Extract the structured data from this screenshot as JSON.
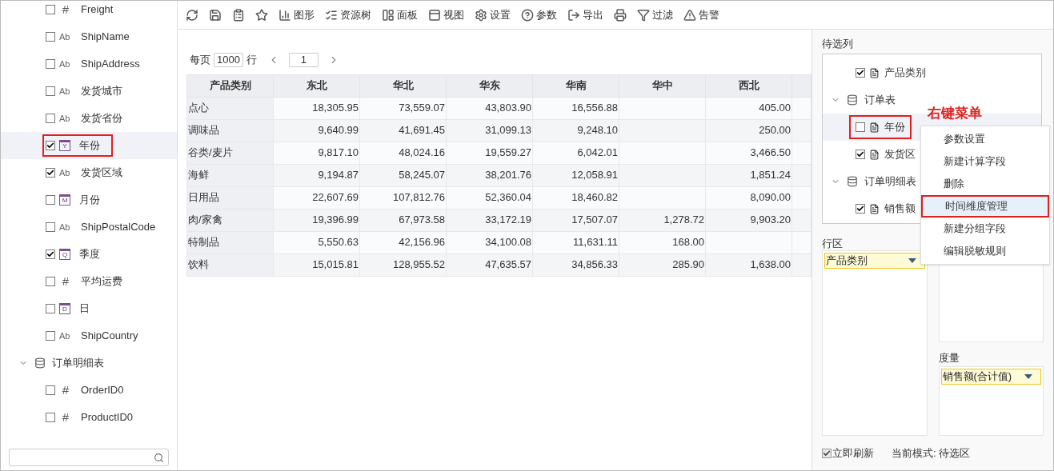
{
  "sidebar": {
    "items": [
      {
        "kind": "number",
        "type_label": "#",
        "label": "Freight",
        "checked": false,
        "selected": false,
        "outlined": false
      },
      {
        "kind": "text",
        "type_label": "Ab",
        "label": "ShipName",
        "checked": false,
        "selected": false,
        "outlined": false
      },
      {
        "kind": "text",
        "type_label": "Ab",
        "label": "ShipAddress",
        "checked": false,
        "selected": false,
        "outlined": false
      },
      {
        "kind": "text",
        "type_label": "Ab",
        "label": "发货城市",
        "checked": false,
        "selected": false,
        "outlined": false
      },
      {
        "kind": "text",
        "type_label": "Ab",
        "label": "发货省份",
        "checked": false,
        "selected": false,
        "outlined": false
      },
      {
        "kind": "date",
        "type_label": "Y",
        "label": "年份",
        "checked": true,
        "selected": true,
        "outlined": true
      },
      {
        "kind": "text",
        "type_label": "Ab",
        "label": "发货区域",
        "checked": true,
        "selected": false,
        "outlined": false
      },
      {
        "kind": "date",
        "type_label": "M",
        "label": "月份",
        "checked": false,
        "selected": false,
        "outlined": false
      },
      {
        "kind": "text",
        "type_label": "Ab",
        "label": "ShipPostalCode",
        "checked": false,
        "selected": false,
        "outlined": false
      },
      {
        "kind": "date",
        "type_label": "Q",
        "label": "季度",
        "checked": true,
        "selected": false,
        "outlined": false
      },
      {
        "kind": "number",
        "type_label": "#",
        "label": "平均运费",
        "checked": false,
        "selected": false,
        "outlined": false
      },
      {
        "kind": "date",
        "type_label": "D",
        "label": "日",
        "checked": false,
        "selected": false,
        "outlined": false
      },
      {
        "kind": "text",
        "type_label": "Ab",
        "label": "ShipCountry",
        "checked": false,
        "selected": false,
        "outlined": false
      },
      {
        "kind": "table",
        "label": "订单明细表",
        "expanded": true,
        "children": [
          {
            "kind": "number",
            "type_label": "#",
            "label": "OrderID0",
            "checked": false,
            "selected": false,
            "outlined": false
          },
          {
            "kind": "number",
            "type_label": "#",
            "label": "ProductID0",
            "checked": false,
            "selected": false,
            "outlined": false
          }
        ]
      }
    ]
  },
  "toolbar": [
    {
      "kind": "refresh"
    },
    {
      "kind": "save"
    },
    {
      "kind": "save-as"
    },
    {
      "kind": "favorite"
    },
    {
      "kind": "chart",
      "label": "图形"
    },
    {
      "kind": "tree",
      "label": "资源树"
    },
    {
      "kind": "panel",
      "label": "面板"
    },
    {
      "kind": "view",
      "label": "视图"
    },
    {
      "kind": "settings",
      "label": "设置"
    },
    {
      "kind": "help",
      "label": "参数"
    },
    {
      "kind": "export",
      "label": "导出"
    },
    {
      "kind": "print"
    },
    {
      "kind": "filter",
      "label": "过滤"
    },
    {
      "kind": "alert",
      "label": "告警"
    }
  ],
  "pager": {
    "prefix": "每页",
    "page_size": "1000",
    "suffix": "行",
    "page": "1"
  },
  "table": {
    "columns": [
      "产品类别",
      "东北",
      "华北",
      "华东",
      "华南",
      "华中",
      "西北"
    ],
    "rows": [
      [
        "点心",
        "18,305.95",
        "73,559.07",
        "43,803.90",
        "16,556.88",
        "",
        "405.00"
      ],
      [
        "调味品",
        "9,640.99",
        "41,691.45",
        "31,099.13",
        "9,248.10",
        "",
        "250.00"
      ],
      [
        "谷类/麦片",
        "9,817.10",
        "48,024.16",
        "19,559.27",
        "6,042.01",
        "",
        "3,466.50"
      ],
      [
        "海鲜",
        "9,194.87",
        "58,245.07",
        "38,201.76",
        "12,058.91",
        "",
        "1,851.24"
      ],
      [
        "日用品",
        "22,607.69",
        "107,812.76",
        "52,360.04",
        "18,460.82",
        "",
        "8,090.00"
      ],
      [
        "肉/家禽",
        "19,396.99",
        "67,973.58",
        "33,172.19",
        "17,507.07",
        "1,278.72",
        "9,903.20"
      ],
      [
        "特制品",
        "5,550.63",
        "42,156.96",
        "34,100.08",
        "11,631.11",
        "168.00",
        ""
      ],
      [
        "饮料",
        "15,015.81",
        "128,955.52",
        "47,635.57",
        "34,856.33",
        "285.90",
        "1,638.00"
      ]
    ]
  },
  "candidates": {
    "title": "待选列",
    "items": [
      {
        "kind": "field",
        "label": "产品类别",
        "checked": true,
        "selected": false,
        "outlined": false
      },
      {
        "kind": "table",
        "label": "订单表",
        "expanded": true,
        "children": [
          {
            "kind": "field",
            "label": "年份",
            "checked": false,
            "selected": true,
            "outlined": true
          },
          {
            "kind": "field",
            "label": "发货区",
            "checked": true,
            "selected": false,
            "outlined": false
          }
        ]
      },
      {
        "kind": "table",
        "label": "订单明细表",
        "expanded": true,
        "children": [
          {
            "kind": "field",
            "label": "销售额",
            "checked": true,
            "selected": false,
            "outlined": false
          }
        ]
      }
    ]
  },
  "annotation": "右键菜单",
  "context_menu": [
    {
      "label": "参数设置",
      "selected": false
    },
    {
      "label": "新建计算字段",
      "selected": false
    },
    {
      "label": "删除",
      "selected": false
    },
    {
      "label": "时间维度管理",
      "selected": true
    },
    {
      "label": "新建分组字段",
      "selected": false
    },
    {
      "label": "编辑脱敏规则",
      "selected": false
    }
  ],
  "row_zone": {
    "title": "行区",
    "chips": [
      "产品类别"
    ]
  },
  "measure_zone": {
    "title": "度量",
    "chips": [
      "销售额(合计值)"
    ]
  },
  "footer": {
    "auto_refresh": {
      "label": "立即刷新",
      "checked": true
    },
    "mode": "当前模式: 待选区"
  }
}
